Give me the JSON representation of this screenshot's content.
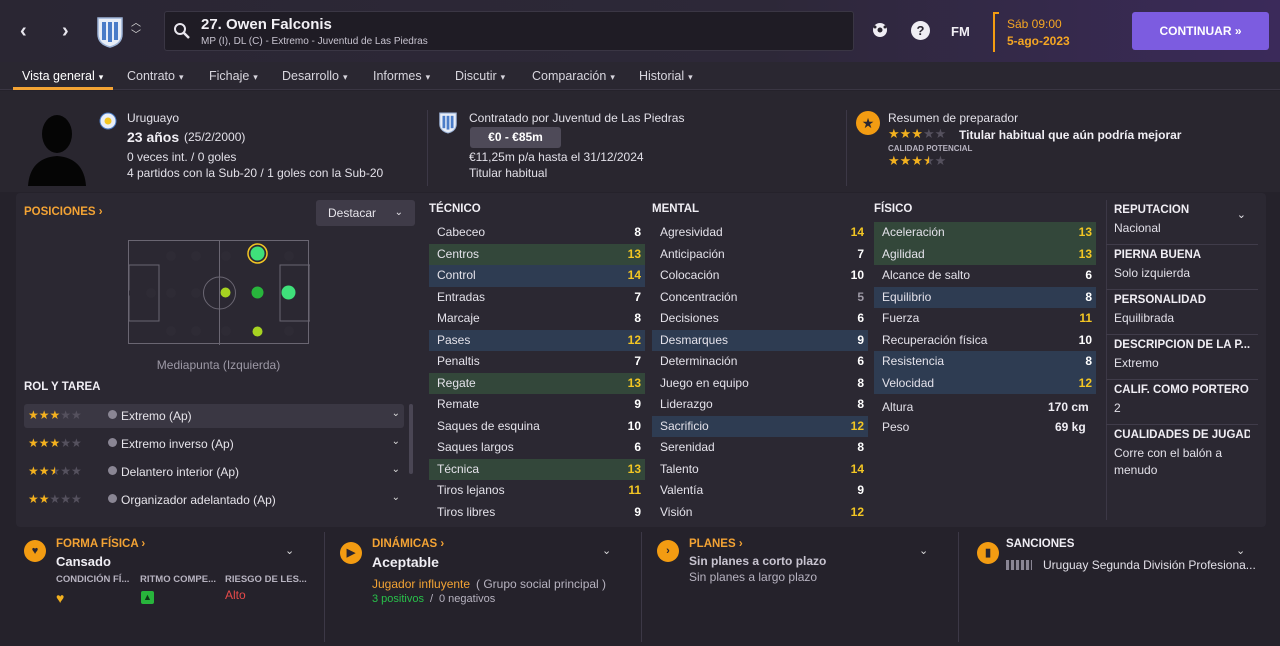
{
  "player": {
    "title": "27. Owen Falconis",
    "subtitle": "MP (I), DL (C) - Extremo - Juventud de Las Piedras"
  },
  "date": {
    "day": "Sáb 09:00",
    "date": "5-ago-2023"
  },
  "topbar": {
    "fm_label": "FM",
    "continue_label": "CONTINUAR",
    "help_label": "?"
  },
  "tabs": [
    {
      "label": "Vista general"
    },
    {
      "label": "Contrato"
    },
    {
      "label": "Fichaje"
    },
    {
      "label": "Desarrollo"
    },
    {
      "label": "Informes"
    },
    {
      "label": "Discutir"
    },
    {
      "label": "Comparación"
    },
    {
      "label": "Historial"
    }
  ],
  "bio": {
    "nationality": "Uruguayo",
    "age": "23 años",
    "dob": "(25/2/2000)",
    "caps": "0 veces int. / 0 goles",
    "youth": "4 partidos con la Sub-20 / 1 goles con la Sub-20"
  },
  "contract": {
    "contracted_by": "Contratado por Juventud de Las Piedras",
    "value": "€0 - €85m",
    "wage": "€11,25m p/a hasta el 31/12/2024",
    "status": "Titular habitual"
  },
  "coach": {
    "title": "Resumen de preparador",
    "summary": "Titular habitual que aún podría mejorar",
    "potential_label": "CALIDAD POTENCIAL",
    "current_stars": 3,
    "potential_stars": 3.5
  },
  "positions": {
    "title": "POSICIONES",
    "dropdown": "Destacar",
    "label": "Mediapunta (Izquierda)"
  },
  "roles": {
    "title": "ROL Y TAREA",
    "items": [
      {
        "name": "Extremo (Ap)",
        "stars": 3
      },
      {
        "name": "Extremo inverso (Ap)",
        "stars": 3
      },
      {
        "name": "Delantero interior (Ap)",
        "stars": 2.5
      },
      {
        "name": "Organizador adelantado (Ap)",
        "stars": 2
      }
    ]
  },
  "attributes": {
    "tecnico": {
      "title": "TÉCNICO",
      "rows": [
        {
          "name": "Cabeceo",
          "value": "8",
          "hl": "",
          "color": "#ffffff"
        },
        {
          "name": "Centros",
          "value": "13",
          "hl": "g",
          "color": "#f3c623"
        },
        {
          "name": "Control",
          "value": "14",
          "hl": "b",
          "color": "#f3c623"
        },
        {
          "name": "Entradas",
          "value": "7",
          "hl": "",
          "color": "#ffffff"
        },
        {
          "name": "Marcaje",
          "value": "8",
          "hl": "",
          "color": "#ffffff"
        },
        {
          "name": "Pases",
          "value": "12",
          "hl": "b",
          "color": "#f3c623"
        },
        {
          "name": "Penaltis",
          "value": "7",
          "hl": "",
          "color": "#ffffff"
        },
        {
          "name": "Regate",
          "value": "13",
          "hl": "g",
          "color": "#f3c623"
        },
        {
          "name": "Remate",
          "value": "9",
          "hl": "",
          "color": "#ffffff"
        },
        {
          "name": "Saques de esquina",
          "value": "10",
          "hl": "",
          "color": "#ffffff"
        },
        {
          "name": "Saques largos",
          "value": "6",
          "hl": "",
          "color": "#ffffff"
        },
        {
          "name": "Técnica",
          "value": "13",
          "hl": "g",
          "color": "#f3c623"
        },
        {
          "name": "Tiros lejanos",
          "value": "11",
          "hl": "",
          "color": "#f3c623"
        },
        {
          "name": "Tiros libres",
          "value": "9",
          "hl": "",
          "color": "#ffffff"
        }
      ]
    },
    "mental": {
      "title": "MENTAL",
      "rows": [
        {
          "name": "Agresividad",
          "value": "14",
          "hl": "",
          "color": "#f3c623"
        },
        {
          "name": "Anticipación",
          "value": "7",
          "hl": "",
          "color": "#ffffff"
        },
        {
          "name": "Colocación",
          "value": "10",
          "hl": "",
          "color": "#ffffff"
        },
        {
          "name": "Concentración",
          "value": "5",
          "hl": "",
          "color": "#9e9aa6"
        },
        {
          "name": "Decisiones",
          "value": "6",
          "hl": "",
          "color": "#ffffff"
        },
        {
          "name": "Desmarques",
          "value": "9",
          "hl": "b",
          "color": "#ffffff"
        },
        {
          "name": "Determinación",
          "value": "6",
          "hl": "",
          "color": "#ffffff"
        },
        {
          "name": "Juego en equipo",
          "value": "8",
          "hl": "",
          "color": "#ffffff"
        },
        {
          "name": "Liderazgo",
          "value": "8",
          "hl": "",
          "color": "#ffffff"
        },
        {
          "name": "Sacrificio",
          "value": "12",
          "hl": "b",
          "color": "#f3c623"
        },
        {
          "name": "Serenidad",
          "value": "8",
          "hl": "",
          "color": "#ffffff"
        },
        {
          "name": "Talento",
          "value": "14",
          "hl": "",
          "color": "#f3c623"
        },
        {
          "name": "Valentía",
          "value": "9",
          "hl": "",
          "color": "#ffffff"
        },
        {
          "name": "Visión",
          "value": "12",
          "hl": "",
          "color": "#f3c623"
        }
      ]
    },
    "fisico": {
      "title": "FÍSICO",
      "rows": [
        {
          "name": "Aceleración",
          "value": "13",
          "hl": "g",
          "color": "#f3c623"
        },
        {
          "name": "Agilidad",
          "value": "13",
          "hl": "g",
          "color": "#f3c623"
        },
        {
          "name": "Alcance de salto",
          "value": "6",
          "hl": "",
          "color": "#ffffff"
        },
        {
          "name": "Equilibrio",
          "value": "8",
          "hl": "b",
          "color": "#ffffff"
        },
        {
          "name": "Fuerza",
          "value": "11",
          "hl": "",
          "color": "#f3c623"
        },
        {
          "name": "Recuperación física",
          "value": "10",
          "hl": "",
          "color": "#ffffff"
        },
        {
          "name": "Resistencia",
          "value": "8",
          "hl": "b",
          "color": "#ffffff"
        },
        {
          "name": "Velocidad",
          "value": "12",
          "hl": "b",
          "color": "#f3c623"
        }
      ],
      "height_label": "Altura",
      "height": "170 cm",
      "weight_label": "Peso",
      "weight": "69 kg"
    }
  },
  "sidebar": [
    {
      "title": "REPUTACIÓN",
      "value": "Nacional"
    },
    {
      "title": "PIERNA BUENA",
      "value": "Solo izquierda"
    },
    {
      "title": "PERSONALIDAD",
      "value": "Equilibrada"
    },
    {
      "title": "DESCRIPCIÓN DE LA P...",
      "value": "Extremo"
    },
    {
      "title": "CALIF. COMO PORTERO",
      "value": "2"
    },
    {
      "title": "CUALIDADES DE JUGADO",
      "value": "Corre con el balón a menudo"
    }
  ],
  "bottom": {
    "forma": {
      "title": "FORMA FÍSICA",
      "value": "Cansado",
      "c1": "CONDICIÓN FÍ...",
      "c2": "RITMO COMPE...",
      "c3": "RIESGO DE LES...",
      "risk": "Alto"
    },
    "dinamicas": {
      "title": "DINÁMICAS",
      "value": "Aceptable",
      "role": "Jugador influyente",
      "group": "( Grupo social principal )",
      "pos": "3 positivos",
      "sep": "/",
      "neg": "0 negativos"
    },
    "planes": {
      "title": "PLANES",
      "short": "Sin planes a corto plazo",
      "long": "Sin planes a largo plazo"
    },
    "sanciones": {
      "title": "SANCIONES",
      "league": "Uruguay Segunda División Profesiona..."
    }
  },
  "colors": {
    "accent": "#f3a334",
    "continue": "#7c5ce0",
    "green_hl": "#33473a",
    "blue_hl": "#2e3c52"
  }
}
